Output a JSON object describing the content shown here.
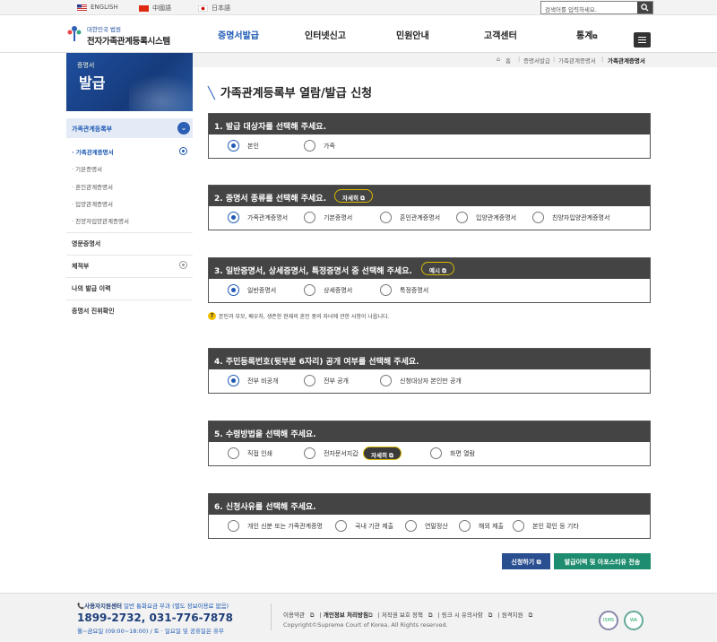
{
  "topbar": {
    "langs": [
      "ENGLISH",
      "中國語",
      "日本語"
    ],
    "search_placeholder": "검색어를 입력하세요."
  },
  "header": {
    "logo_small": "대한민국 법원",
    "logo_title": "전자가족관계등록시스템",
    "nav": [
      "증명서발급",
      "인터넷신고",
      "민원안내",
      "고객센터",
      "통계"
    ]
  },
  "visual": {
    "line1": "증명서",
    "line2": "발급"
  },
  "breadcrumb": [
    "홈",
    "증명서발급",
    "가족관계증명서",
    "가족관계증명서"
  ],
  "lnb": {
    "top": "가족관계등록부",
    "subs": [
      "가족관계증명서",
      "기본증명서",
      "혼인관계증명서",
      "입양관계증명서",
      "친양자입양관계증명서"
    ],
    "menus": [
      "영문증명서",
      "제적부",
      "나의 발급 이력",
      "증명서 진위확인"
    ]
  },
  "page_title": "가족관계등록부 열람/발급 신청",
  "q1": {
    "head": "1. 발급 대상자를 선택해 주세요.",
    "opts": [
      "본인",
      "가족"
    ]
  },
  "q2": {
    "head": "2. 증명서 종류를 선택해 주세요.",
    "pill": "자세히",
    "opts": [
      "가족관계증명서",
      "기본증명서",
      "혼인관계증명서",
      "입양관계증명서",
      "친양자입양관계증명서"
    ]
  },
  "q3": {
    "head": "3. 일반증명서, 상세증명서, 특정증명서 중 선택해 주세요.",
    "pill": "예시",
    "opts": [
      "일반증명서",
      "상세증명서",
      "특정증명서"
    ],
    "note": "본인과 부모, 배우자, 생존한 현재의 혼인 중의 자녀에 관한 사항이 나옵니다."
  },
  "q4": {
    "head": "4. 주민등록번호(뒷부분 6자리) 공개 여부를 선택해 주세요.",
    "opts": [
      "전부 비공개",
      "전부 공개",
      "신청대상자 본인만 공개"
    ]
  },
  "q5": {
    "head": "5. 수령방법을 선택해 주세요.",
    "pill": "자세히",
    "opts": [
      "직접 인쇄",
      "전자문서지갑",
      "화면 열람"
    ]
  },
  "q6": {
    "head": "6. 신청사유를 선택해 주세요.",
    "opts": [
      "개인 신분 또는 가족관계증명",
      "국내 기관 제출",
      "연말정산",
      "해외 제출",
      "본인 확인 등 기타"
    ]
  },
  "buttons": {
    "apply": "신청하기",
    "history": "발급이력 및 아포스티유 전송"
  },
  "footer": {
    "center": "사용자지원센터",
    "center_note": " 일반 통화요금 부과 (별도 정보이용료 없음)",
    "tel": "1899-2732, 031-776-7878",
    "hours": "월~금요일 (09:00~18:00) / 토 · 일요일 및 공휴일은 휴무",
    "links": [
      "이용약관",
      "개인정보 처리방침",
      "저작권 보호 정책",
      "링크 시 유의사항",
      "원격지원"
    ],
    "copyright": "Copyright©Supreme Court of Korea. All Rights reserved.",
    "cert1": "ISMS",
    "cert2": "WA"
  }
}
